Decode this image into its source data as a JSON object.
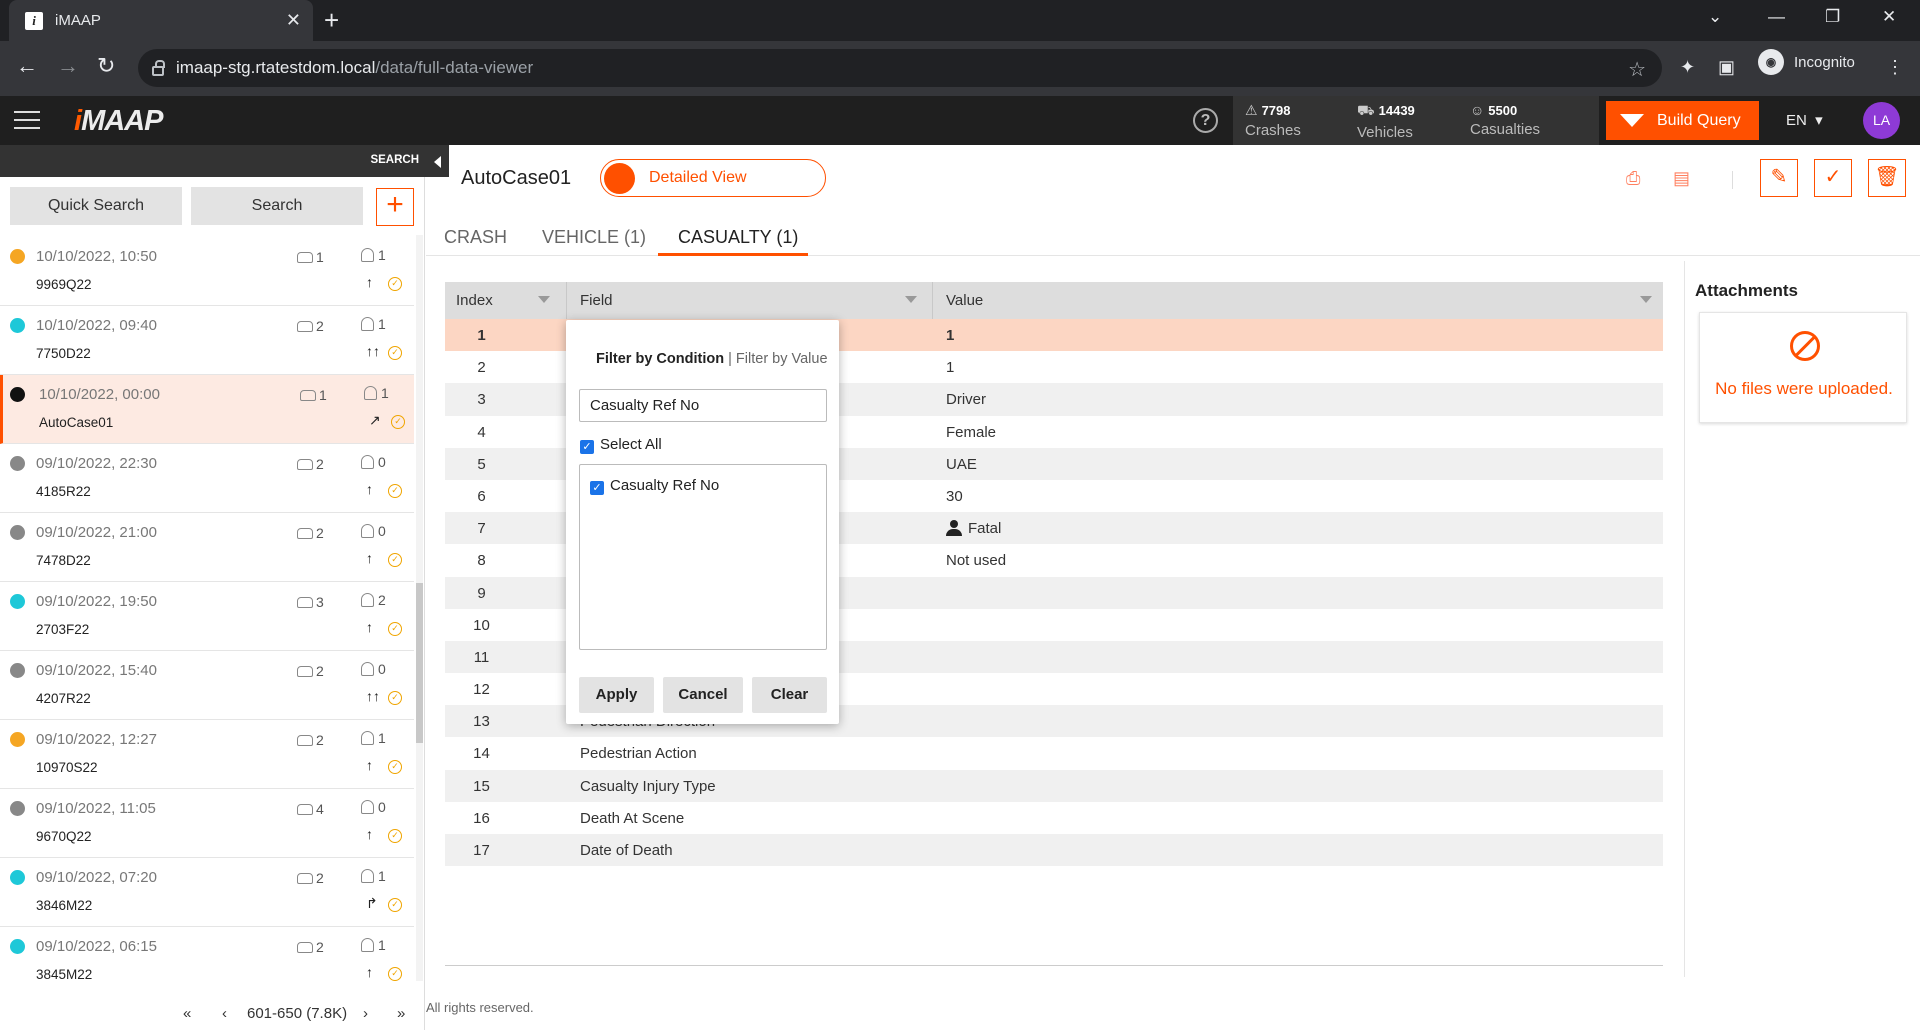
{
  "browser": {
    "tab_title": "iMAAP",
    "tab_favicon": "i",
    "url_host": "imaap-stg.rtatestdom.local",
    "url_path": "/data/full-data-viewer",
    "incognito_label": "Incognito"
  },
  "header": {
    "logo_prefix": "i",
    "logo_suffix": "MAAP",
    "stats": [
      {
        "value": "7798",
        "label": "Crashes",
        "icon": "crash-icon"
      },
      {
        "value": "14439",
        "label": "Vehicles",
        "icon": "vehicle-icon"
      },
      {
        "value": "5500",
        "label": "Casualties",
        "icon": "person-icon"
      }
    ],
    "build_query_label": "Build Query",
    "language": "EN",
    "avatar_initials": "LA",
    "accent_color": "#ff5000"
  },
  "sidebar": {
    "search_strip_label": "SEARCH",
    "quick_search_label": "Quick Search",
    "search_label": "Search",
    "add_label": "+",
    "cases": [
      {
        "datetime": "10/10/2022, 10:50",
        "ref": "9969Q22",
        "vehicles": "1",
        "casualties": "1",
        "walk": "↑",
        "color": "#f5a623"
      },
      {
        "datetime": "10/10/2022, 09:40",
        "ref": "7750D22",
        "vehicles": "2",
        "casualties": "1",
        "walk": "↑↑",
        "color": "#1ec8d8"
      },
      {
        "datetime": "10/10/2022, 00:00",
        "ref": "AutoCase01",
        "vehicles": "1",
        "casualties": "1",
        "walk": "↗",
        "color": "#111111",
        "selected": true
      },
      {
        "datetime": "09/10/2022, 22:30",
        "ref": "4185R22",
        "vehicles": "2",
        "casualties": "0",
        "walk": "↑",
        "color": "#888888"
      },
      {
        "datetime": "09/10/2022, 21:00",
        "ref": "7478D22",
        "vehicles": "2",
        "casualties": "0",
        "walk": "↑",
        "color": "#888888"
      },
      {
        "datetime": "09/10/2022, 19:50",
        "ref": "2703F22",
        "vehicles": "3",
        "casualties": "2",
        "walk": "↑",
        "color": "#1ec8d8"
      },
      {
        "datetime": "09/10/2022, 15:40",
        "ref": "4207R22",
        "vehicles": "2",
        "casualties": "0",
        "walk": "↑↑",
        "color": "#888888"
      },
      {
        "datetime": "09/10/2022, 12:27",
        "ref": "10970S22",
        "vehicles": "2",
        "casualties": "1",
        "walk": "↑",
        "color": "#f5a623"
      },
      {
        "datetime": "09/10/2022, 11:05",
        "ref": "9670Q22",
        "vehicles": "4",
        "casualties": "0",
        "walk": "↑",
        "color": "#888888"
      },
      {
        "datetime": "09/10/2022, 07:20",
        "ref": "3846M22",
        "vehicles": "2",
        "casualties": "1",
        "walk": "↱",
        "color": "#1ec8d8"
      },
      {
        "datetime": "09/10/2022, 06:15",
        "ref": "3845M22",
        "vehicles": "2",
        "casualties": "1",
        "walk": "↑",
        "color": "#1ec8d8"
      }
    ],
    "pager": {
      "first": "«",
      "prev": "‹",
      "range": "601-650 (7.8K)",
      "next": "›",
      "last": "»"
    }
  },
  "main": {
    "case_title": "AutoCase01",
    "view_toggle_label": "Detailed View",
    "tabs": [
      {
        "label": "CRASH"
      },
      {
        "label": "VEHICLE (1)"
      },
      {
        "label": "CASUALTY (1)",
        "active": true
      }
    ],
    "grid": {
      "columns": [
        "Index",
        "Field",
        "Value"
      ],
      "rows": [
        {
          "index": "1",
          "field": "",
          "value": "1",
          "selected": true
        },
        {
          "index": "2",
          "field": "",
          "value": "1"
        },
        {
          "index": "3",
          "field": "",
          "value": "Driver"
        },
        {
          "index": "4",
          "field": "",
          "value": "Female"
        },
        {
          "index": "5",
          "field": "",
          "value": "UAE"
        },
        {
          "index": "6",
          "field": "",
          "value": "30"
        },
        {
          "index": "7",
          "field": "",
          "value": "Fatal",
          "icon": "fatal-person-icon"
        },
        {
          "index": "8",
          "field": "",
          "value": "Not used"
        },
        {
          "index": "9",
          "field": "",
          "value": ""
        },
        {
          "index": "10",
          "field": "",
          "value": ""
        },
        {
          "index": "11",
          "field": "",
          "value": ""
        },
        {
          "index": "12",
          "field": "",
          "value": ""
        },
        {
          "index": "13",
          "field": "Pedestrian Direction",
          "value": ""
        },
        {
          "index": "14",
          "field": "Pedestrian Action",
          "value": ""
        },
        {
          "index": "15",
          "field": "Casualty Injury Type",
          "value": ""
        },
        {
          "index": "16",
          "field": "Death At Scene",
          "value": ""
        },
        {
          "index": "17",
          "field": "Date of Death",
          "value": ""
        }
      ]
    },
    "attachments": {
      "title": "Attachments",
      "empty_text": "No files were uploaded."
    },
    "footer": "All rights reserved."
  },
  "filter_popup": {
    "tab_condition": "Filter by Condition",
    "separator": "|",
    "tab_value": "Filter by Value",
    "input_value": "Casualty Ref No",
    "select_all_label": "Select All",
    "items": [
      "Casualty Ref No"
    ],
    "apply_label": "Apply",
    "cancel_label": "Cancel",
    "clear_label": "Clear"
  }
}
